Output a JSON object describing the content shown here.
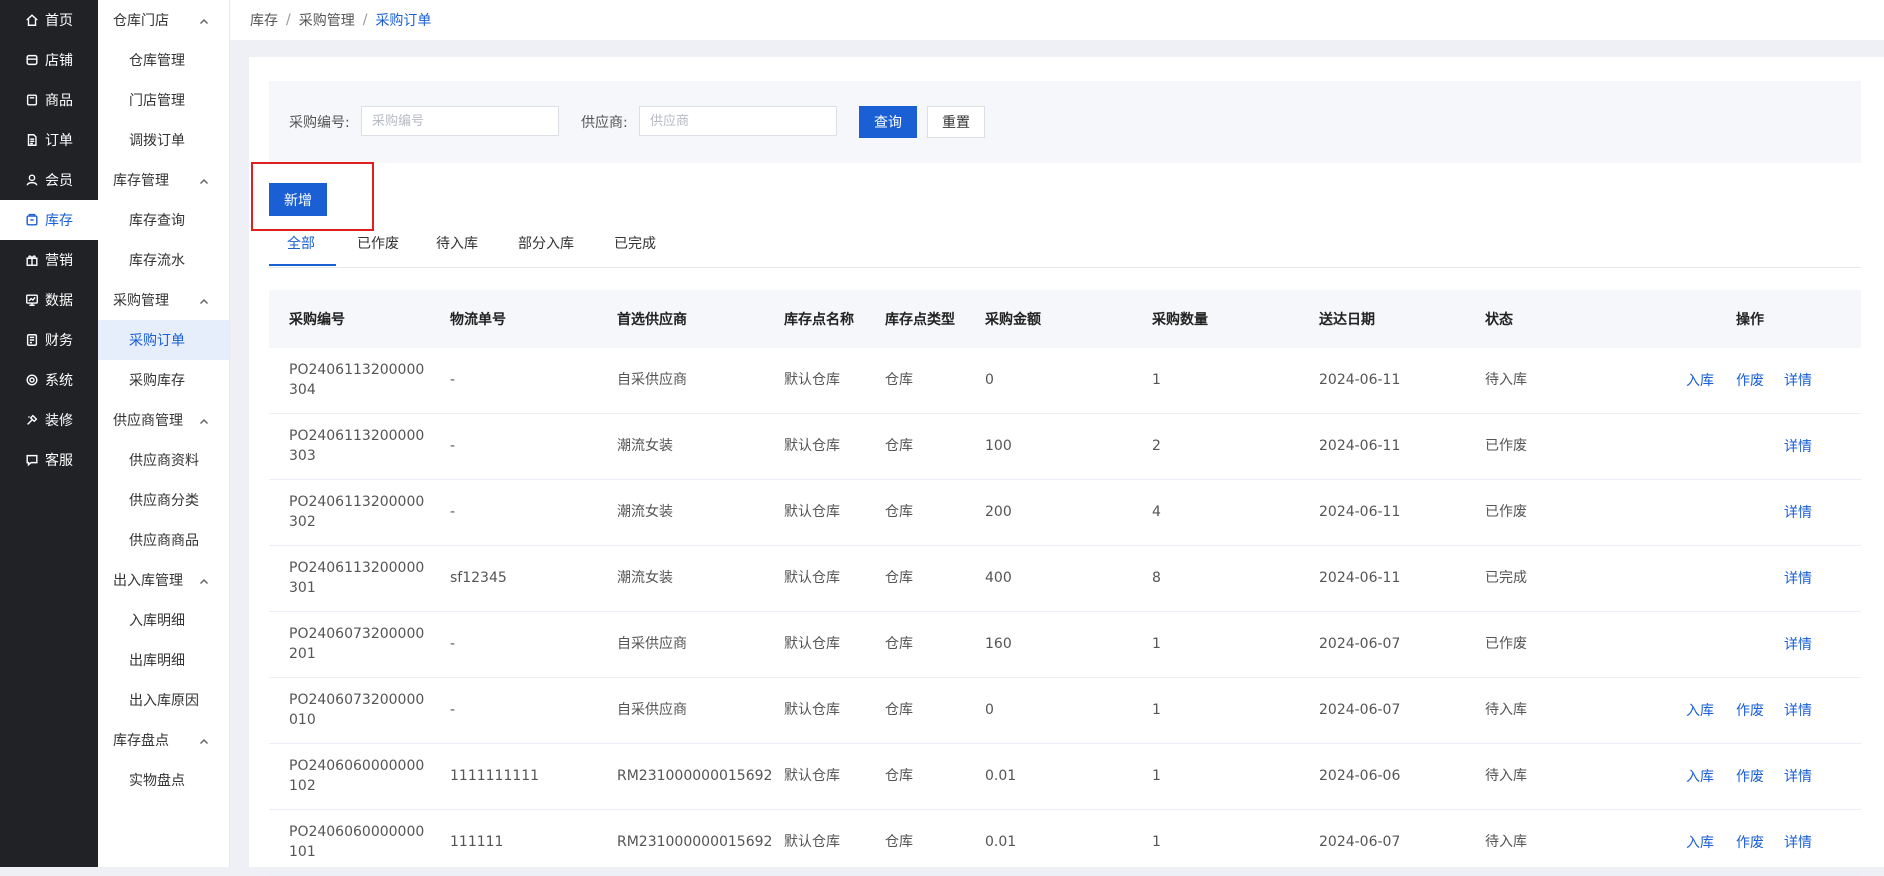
{
  "nav": [
    {
      "label": "首页",
      "icon": "home-icon",
      "active": false
    },
    {
      "label": "店铺",
      "icon": "store-icon",
      "active": false
    },
    {
      "label": "商品",
      "icon": "product-icon",
      "active": false
    },
    {
      "label": "订单",
      "icon": "order-icon",
      "active": false
    },
    {
      "label": "会员",
      "icon": "member-icon",
      "active": false
    },
    {
      "label": "库存",
      "icon": "inventory-icon",
      "active": true
    },
    {
      "label": "营销",
      "icon": "gift-icon",
      "active": false
    },
    {
      "label": "数据",
      "icon": "data-icon",
      "active": false
    },
    {
      "label": "财务",
      "icon": "finance-icon",
      "active": false
    },
    {
      "label": "系统",
      "icon": "gear-icon",
      "active": false
    },
    {
      "label": "装修",
      "icon": "decorate-icon",
      "active": false
    },
    {
      "label": "客服",
      "icon": "chat-icon",
      "active": false
    }
  ],
  "sidebar": [
    {
      "title": "仓库门店",
      "items": [
        {
          "label": "仓库管理",
          "active": false
        },
        {
          "label": "门店管理",
          "active": false
        },
        {
          "label": "调拨订单",
          "active": false
        }
      ]
    },
    {
      "title": "库存管理",
      "items": [
        {
          "label": "库存查询",
          "active": false
        },
        {
          "label": "库存流水",
          "active": false
        }
      ]
    },
    {
      "title": "采购管理",
      "items": [
        {
          "label": "采购订单",
          "active": true
        },
        {
          "label": "采购库存",
          "active": false
        }
      ]
    },
    {
      "title": "供应商管理",
      "items": [
        {
          "label": "供应商资料",
          "active": false
        },
        {
          "label": "供应商分类",
          "active": false
        },
        {
          "label": "供应商商品",
          "active": false
        }
      ]
    },
    {
      "title": "出入库管理",
      "items": [
        {
          "label": "入库明细",
          "active": false
        },
        {
          "label": "出库明细",
          "active": false
        },
        {
          "label": "出入库原因",
          "active": false
        }
      ]
    },
    {
      "title": "库存盘点",
      "items": [
        {
          "label": "实物盘点",
          "active": false
        }
      ]
    }
  ],
  "breadcrumb": {
    "level1": "库存",
    "level2": "采购管理",
    "current": "采购订单",
    "separator": "/"
  },
  "filter": {
    "code_label": "采购编号:",
    "code_placeholder": "采购编号",
    "code_value": "",
    "supplier_label": "供应商:",
    "supplier_placeholder": "供应商",
    "supplier_value": "",
    "search_button": "查询",
    "reset_button": "重置"
  },
  "add_button": "新增",
  "tabs": [
    {
      "label": "全部",
      "active": true
    },
    {
      "label": "已作废",
      "active": false
    },
    {
      "label": "待入库",
      "active": false
    },
    {
      "label": "部分入库",
      "active": false
    },
    {
      "label": "已完成",
      "active": false
    }
  ],
  "table": {
    "headers": {
      "code": "采购编号",
      "logistics": "物流单号",
      "supplier": "首选供应商",
      "location_name": "库存点名称",
      "location_type": "库存点类型",
      "amount": "采购金额",
      "quantity": "采购数量",
      "date": "送达日期",
      "status": "状态",
      "actions": "操作"
    },
    "action_labels": {
      "stock_in": "入库",
      "void": "作废",
      "detail": "详情"
    },
    "rows": [
      {
        "code": "PO2406113200000304",
        "logistics": "-",
        "supplier": "自采供应商",
        "location_name": "默认仓库",
        "location_type": "仓库",
        "amount": "0",
        "quantity": "1",
        "date": "2024-06-11",
        "status": "待入库",
        "actions": [
          "stock_in",
          "void",
          "detail"
        ]
      },
      {
        "code": "PO2406113200000303",
        "logistics": "-",
        "supplier": "潮流女装",
        "location_name": "默认仓库",
        "location_type": "仓库",
        "amount": "100",
        "quantity": "2",
        "date": "2024-06-11",
        "status": "已作废",
        "actions": [
          "detail"
        ]
      },
      {
        "code": "PO2406113200000302",
        "logistics": "-",
        "supplier": "潮流女装",
        "location_name": "默认仓库",
        "location_type": "仓库",
        "amount": "200",
        "quantity": "4",
        "date": "2024-06-11",
        "status": "已作废",
        "actions": [
          "detail"
        ]
      },
      {
        "code": "PO2406113200000301",
        "logistics": "sf12345",
        "supplier": "潮流女装",
        "location_name": "默认仓库",
        "location_type": "仓库",
        "amount": "400",
        "quantity": "8",
        "date": "2024-06-11",
        "status": "已完成",
        "actions": [
          "detail"
        ]
      },
      {
        "code": "PO2406073200000201",
        "logistics": "-",
        "supplier": "自采供应商",
        "location_name": "默认仓库",
        "location_type": "仓库",
        "amount": "160",
        "quantity": "1",
        "date": "2024-06-07",
        "status": "已作废",
        "actions": [
          "detail"
        ]
      },
      {
        "code": "PO2406073200000010",
        "logistics": "-",
        "supplier": "自采供应商",
        "location_name": "默认仓库",
        "location_type": "仓库",
        "amount": "0",
        "quantity": "1",
        "date": "2024-06-07",
        "status": "待入库",
        "actions": [
          "stock_in",
          "void",
          "detail"
        ]
      },
      {
        "code": "PO2406060000000102",
        "logistics": "1111111111",
        "supplier": "RM231000000015692",
        "location_name": "默认仓库",
        "location_type": "仓库",
        "amount": "0.01",
        "quantity": "1",
        "date": "2024-06-06",
        "status": "待入库",
        "actions": [
          "stock_in",
          "void",
          "detail"
        ]
      },
      {
        "code": "PO2406060000000101",
        "logistics": "111111",
        "supplier": "RM231000000015692",
        "location_name": "默认仓库",
        "location_type": "仓库",
        "amount": "0.01",
        "quantity": "1",
        "date": "2024-06-07",
        "status": "待入库",
        "actions": [
          "stock_in",
          "void",
          "detail"
        ]
      }
    ]
  },
  "colors": {
    "accent": "#1a5fd4",
    "nav_bg": "#202226",
    "highlight": "#e02020"
  }
}
